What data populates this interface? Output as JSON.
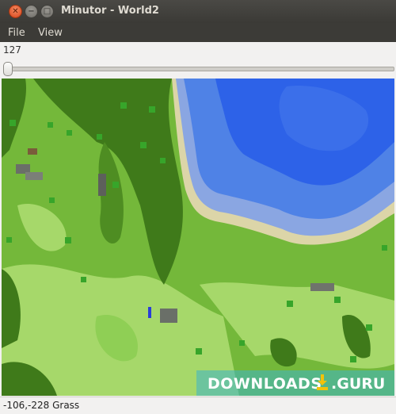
{
  "window": {
    "title": "Minutor - World2",
    "close_glyph": "✕",
    "minimize_glyph": "−",
    "maximize_glyph": "□"
  },
  "menu": {
    "items": [
      "File",
      "View"
    ]
  },
  "depth": {
    "value": "127",
    "slider_fraction": 0.0
  },
  "watermark": {
    "left_text": "DOWNLOADS",
    "right_text": ".GURU"
  },
  "status": {
    "text": "-106,-228 Grass"
  },
  "colors": {
    "grass": "#74b83a",
    "dark_grass": "#3f7a1a",
    "light_grass": "#a6d86a",
    "deep_water": "#2d62e8",
    "water": "#4f82e6",
    "shallow_water": "#8aa6e2",
    "sand": "#dcd5a8",
    "tree": "#37a52a"
  }
}
